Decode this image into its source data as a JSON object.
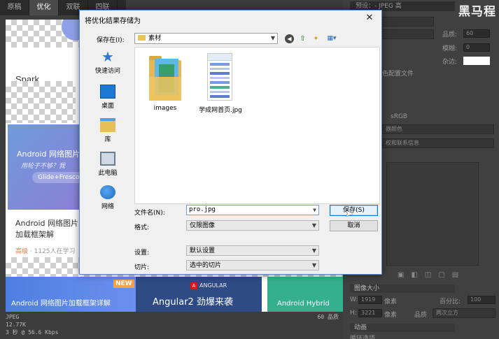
{
  "ps": {
    "tabs": [
      {
        "label": "原稿",
        "active": false
      },
      {
        "label": "优化",
        "active": true
      },
      {
        "label": "双联",
        "active": false
      },
      {
        "label": "四联",
        "active": false
      }
    ],
    "preview": {
      "spark_label": "Spark",
      "hero_title": "Android 网络图片加",
      "hero_sub": "用轮子不够？我",
      "hero_pill": "Glide+Fresco",
      "course_title": "Android 网络图片加载框架解",
      "course_level": "高级",
      "course_meta": "· 1125人在学习",
      "banner1_badge": "NEW",
      "banner1_text": "Android 网络图片加载框架详解",
      "banner2_logo": "ANGULAR",
      "banner2_text": "Angular2 劲爆来袭",
      "banner3_text": "Android Hybrid"
    },
    "status": {
      "format": "JPEG",
      "size": "12.77K",
      "speed": "3 秒 @ 56.6 Kbps",
      "quality": "60 品质"
    },
    "right_panel": {
      "brand": "黑马程",
      "preset": "预设：- JPEG 高",
      "quality_label": "品质:",
      "quality_value": "60",
      "blur_label": "模糊:",
      "blur_value": "0",
      "matte_label": "杂边:",
      "color_profile_label": "色配置文件",
      "srgb_label": "sRGB",
      "display_color": "器颜色",
      "copyright": "权和联系信息",
      "image_size_label": "图像大小",
      "width_label": "W:",
      "width_value": "1919",
      "height_label": "H:",
      "height_value": "3221",
      "unit": "像素",
      "percent_label": "百分比:",
      "percent_value": "100",
      "quality2_label": "品质",
      "quality2_value": "两次立方",
      "animation_label": "动画",
      "loop_label": "循环选项"
    }
  },
  "dialog": {
    "title": "将优化结果存储为",
    "save_in_label": "保存在(I):",
    "save_in_value": "素材",
    "places": [
      {
        "name": "place-quick-access",
        "label": "快速访问",
        "icon": "star-icon"
      },
      {
        "name": "place-desktop",
        "label": "桌面",
        "icon": "desktop-icon"
      },
      {
        "name": "place-library",
        "label": "库",
        "icon": "library-icon"
      },
      {
        "name": "place-this-pc",
        "label": "此电脑",
        "icon": "computer-icon"
      },
      {
        "name": "place-network",
        "label": "网络",
        "icon": "network-icon"
      }
    ],
    "files": [
      {
        "name": "images",
        "type": "folder"
      },
      {
        "name": "学成网首页.jpg",
        "type": "image"
      }
    ],
    "filename_label": "文件名(N):",
    "filename_value": "pro.jpg",
    "format_label": "格式:",
    "format_value": "仅限图像",
    "settings_label": "设置:",
    "settings_value": "默认设置",
    "slices_label": "切片:",
    "slices_value": "选中的切片",
    "save_button": "保存(S)",
    "cancel_button": "取消"
  }
}
